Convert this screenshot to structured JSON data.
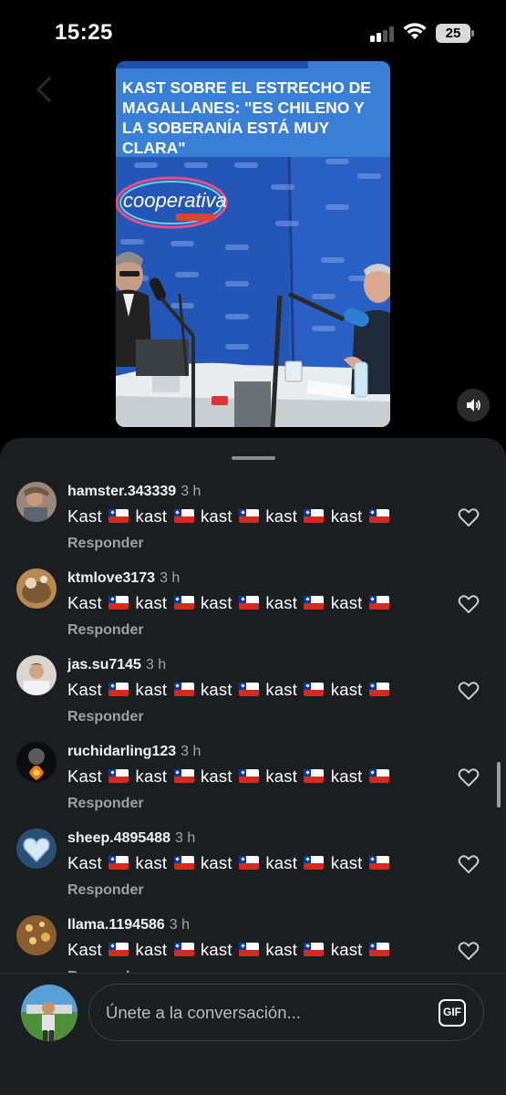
{
  "status_bar": {
    "time": "15:25",
    "battery": "25"
  },
  "video": {
    "headline": "KAST SOBRE EL ESTRECHO DE MAGALLANES: \"ES CHILENO Y LA SOBERANÍA ESTÁ MUY CLARA\"",
    "logo_text": "cooperativa"
  },
  "comments": [
    {
      "user": "hamster.343339",
      "time": "3 h",
      "reply": "Responder"
    },
    {
      "user": "ktmlove3173",
      "time": "3 h",
      "reply": "Responder"
    },
    {
      "user": "jas.su7145",
      "time": "3 h",
      "reply": "Responder"
    },
    {
      "user": "ruchidarling123",
      "time": "3 h",
      "reply": "Responder"
    },
    {
      "user": "sheep.4895488",
      "time": "3 h",
      "reply": "Responder"
    },
    {
      "user": "llama.1194586",
      "time": "3 h",
      "reply": "Responder"
    }
  ],
  "comment_words": [
    "Kast",
    "kast",
    "kast",
    "kast",
    "kast"
  ],
  "composer": {
    "placeholder": "Únete a la conversación...",
    "gif_label": "GIF"
  },
  "colors": {
    "sheet_bg": "#1c1f22",
    "flag_red": "#d52b1e",
    "flag_blue": "#0039a6",
    "video_blue": "#3a7fd6"
  }
}
